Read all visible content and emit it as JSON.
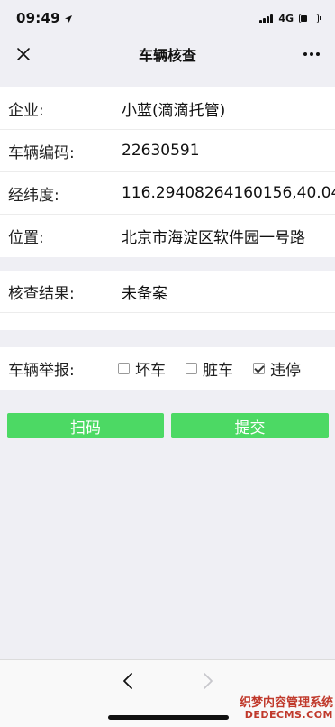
{
  "status": {
    "time": "09:49",
    "network": "4G",
    "battery_level": 0.4
  },
  "nav": {
    "title": "车辆核查",
    "close_icon": "close-icon",
    "more_icon": "more-horizontal-icon"
  },
  "info": {
    "rows": [
      {
        "label": "企业:",
        "value": "小蓝(滴滴托管)"
      },
      {
        "label": "车辆编码:",
        "value": "22630591"
      },
      {
        "label": "经纬度:",
        "value": "116.29408264160156,40.04"
      },
      {
        "label": "位置:",
        "value": "北京市海淀区软件园一号路"
      }
    ]
  },
  "result": {
    "label": "核查结果:",
    "value": "未备案"
  },
  "report": {
    "label": "车辆举报:",
    "options": [
      {
        "label": "坏车",
        "checked": false
      },
      {
        "label": "脏车",
        "checked": false
      },
      {
        "label": "违停",
        "checked": true
      }
    ]
  },
  "actions": {
    "scan_label": "扫码",
    "submit_label": "提交",
    "button_color": "#4cd964"
  },
  "toolbar": {
    "back_icon": "chevron-left-icon",
    "forward_icon": "chevron-right-icon"
  },
  "watermark": {
    "line1": "织梦内容管理系统",
    "line2": "DEDECMS.COM"
  }
}
